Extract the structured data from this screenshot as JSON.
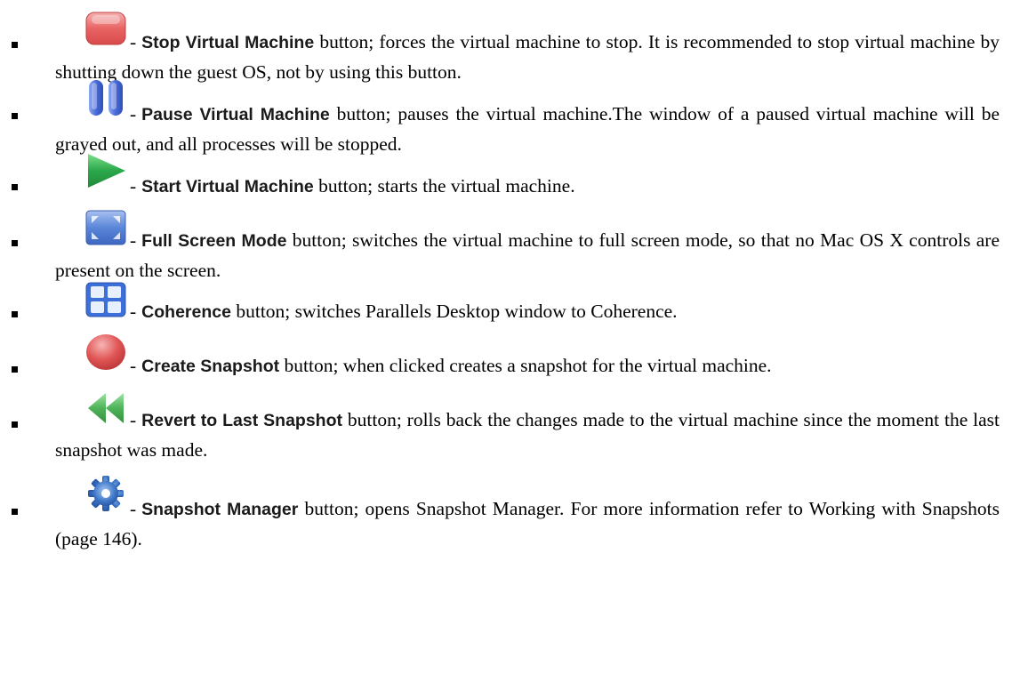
{
  "colors": {
    "stop": "#e86464",
    "pause": "#4a6bd8",
    "start": "#2aa84a",
    "fullscreen": "#5a86d8",
    "coherence": "#3d6fd8",
    "snapshot": "#e05555",
    "revert": "#4fb35a",
    "manager": "#3f78c8"
  },
  "items": [
    {
      "icon": "stop-button-icon",
      "name": "Stop Virtual Machine",
      "desc": " button; forces the virtual machine to stop. It is recommended to stop virtual machine by shutting down the guest OS, not by using this button."
    },
    {
      "icon": "pause-button-icon",
      "name": "Pause Virtual Machine",
      "desc": " button; pauses the virtual machine.The window of a paused virtual machine will be grayed out, and all processes will be stopped."
    },
    {
      "icon": "start-button-icon",
      "name": "Start Virtual Machine",
      "desc": " button; starts the virtual machine."
    },
    {
      "icon": "full-screen-icon",
      "name": "Full Screen Mode",
      "desc": " button; switches the virtual machine to full screen mode, so that no Mac OS X controls are present on the screen."
    },
    {
      "icon": "coherence-icon",
      "name": "Coherence",
      "desc": " button; switches Parallels Desktop window to Coherence."
    },
    {
      "icon": "create-snapshot-icon",
      "name": "Create Snapshot",
      "desc": " button; when clicked creates a snapshot for the virtual machine."
    },
    {
      "icon": "revert-snapshot-icon",
      "name": "Revert to Last Snapshot",
      "desc": " button; rolls back the changes made to the virtual machine since the moment the last snapshot was made."
    },
    {
      "icon": "snapshot-manager-icon",
      "name": "Snapshot Manager",
      "desc": " button; opens Snapshot Manager. For more information refer to Working with Snapshots (page 146)."
    }
  ],
  "dash": "-"
}
